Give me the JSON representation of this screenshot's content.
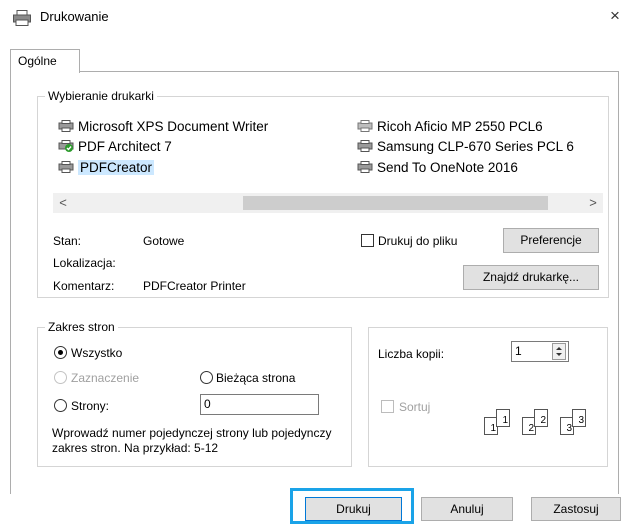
{
  "window": {
    "title": "Drukowanie",
    "close_label": "×"
  },
  "tabs": [
    {
      "label": "Ogólne"
    }
  ],
  "printer_group": {
    "label": "Wybieranie drukarki",
    "printers": [
      {
        "name": "Microsoft XPS Document Writer"
      },
      {
        "name": "PDF Architect 7"
      },
      {
        "name": "PDFCreator",
        "selected": true
      },
      {
        "name": "Ricoh Aficio MP 2550 PCL6"
      },
      {
        "name": "Samsung CLP-670 Series PCL 6"
      },
      {
        "name": "Send To OneNote 2016"
      }
    ],
    "scroll_left": "<",
    "scroll_right": ">"
  },
  "status": {
    "state_label": "Stan:",
    "state_value": "Gotowe",
    "location_label": "Lokalizacja:",
    "location_value": "",
    "comment_label": "Komentarz:",
    "comment_value": "PDFCreator Printer"
  },
  "print_to_file": {
    "label": "Drukuj do pliku",
    "checked": false
  },
  "buttons": {
    "preferences": "Preferencje",
    "find_printer": "Znajdź drukarkę...",
    "print": "Drukuj",
    "cancel": "Anuluj",
    "apply": "Zastosuj"
  },
  "page_range": {
    "label": "Zakres stron",
    "all": "Wszystko",
    "selection": "Zaznaczenie",
    "current_page": "Bieżąca strona",
    "pages": "Strony:",
    "pages_value": "0",
    "hint": "Wprowadź numer pojedynczej strony lub pojedynczy zakres stron. Na przykład: 5-12"
  },
  "copies": {
    "label": "Liczba kopii:",
    "value": "1",
    "collate": "Sortuj",
    "collate_checked": false,
    "collate_pages": [
      "1",
      "1",
      "2",
      "2",
      "3",
      "3"
    ]
  },
  "colors": {
    "highlight": "#1aa3e8",
    "selection": "#cce8ff"
  }
}
